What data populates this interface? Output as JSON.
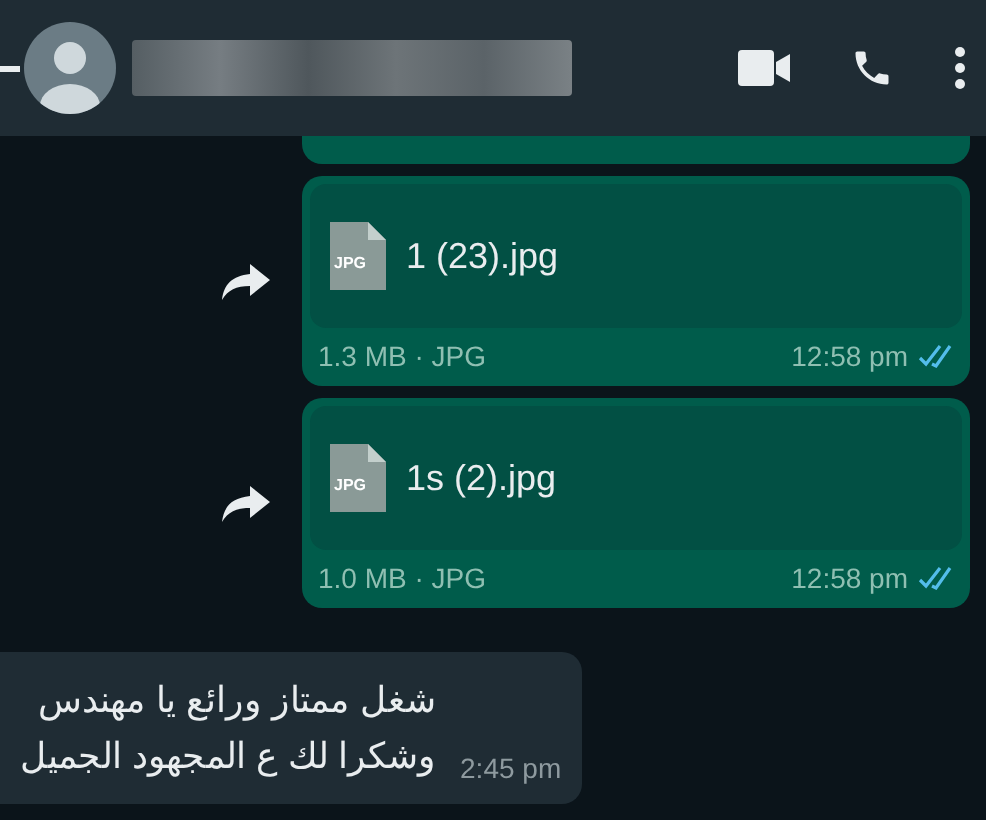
{
  "header": {
    "has_back": true
  },
  "messages": [
    {
      "kind": "document",
      "outgoing": true,
      "cut": true
    },
    {
      "kind": "document",
      "outgoing": true,
      "file_name": "1 (23).jpg",
      "file_type": "JPG",
      "meta": "1.3 MB · JPG",
      "time": "12:58 pm",
      "read": true
    },
    {
      "kind": "document",
      "outgoing": true,
      "file_name": "1s (2).jpg",
      "file_type": "JPG",
      "meta": "1.0 MB · JPG",
      "time": "12:58 pm",
      "read": true
    },
    {
      "kind": "text",
      "outgoing": false,
      "lines": [
        "شغل ممتاز ورائع يا مهندس",
        "وشكرا لك ع المجهود الجميل"
      ],
      "time": "2:45 pm"
    }
  ]
}
